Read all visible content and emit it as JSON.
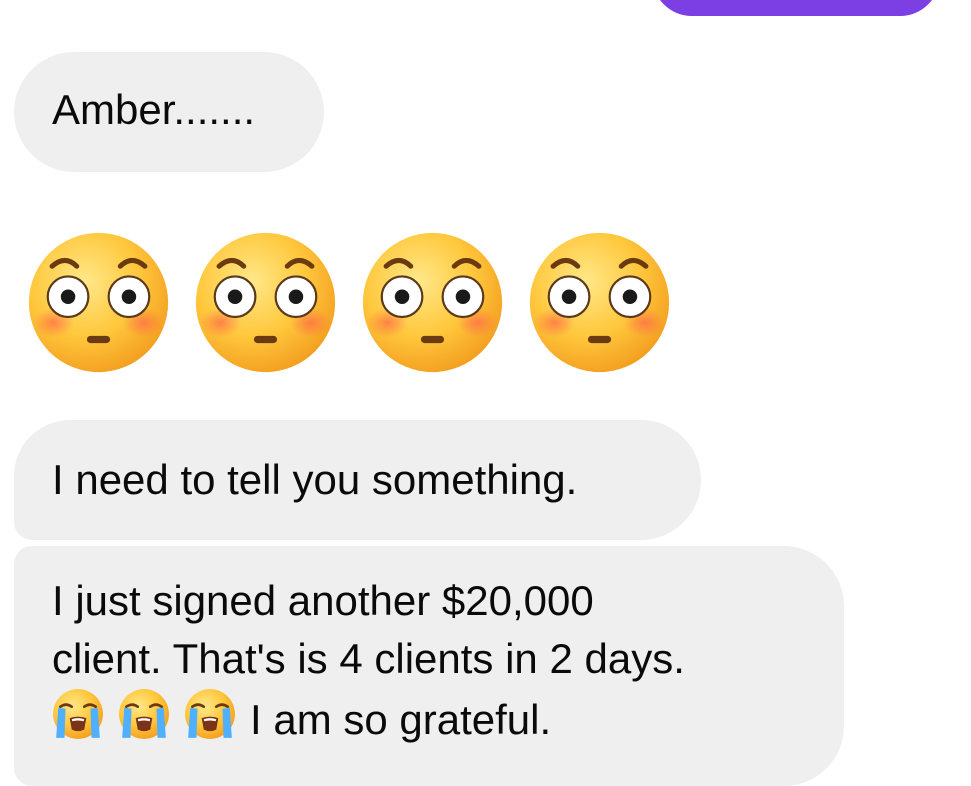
{
  "thread": {
    "outgoing_color": "#7b3fe4",
    "incoming_bg": "#efefef",
    "messages": [
      {
        "text": "Amber......."
      },
      {
        "emoji": [
          "flushed-face",
          "flushed-face",
          "flushed-face",
          "flushed-face"
        ]
      },
      {
        "text": "I need to tell you something."
      },
      {
        "lines": [
          "I just signed another $20,000",
          "client. That's is 4 clients in 2 days."
        ],
        "emoji_prefix": [
          "loudly-crying-face",
          "loudly-crying-face",
          "loudly-crying-face"
        ],
        "last_line_text": "I am so grateful."
      }
    ]
  }
}
